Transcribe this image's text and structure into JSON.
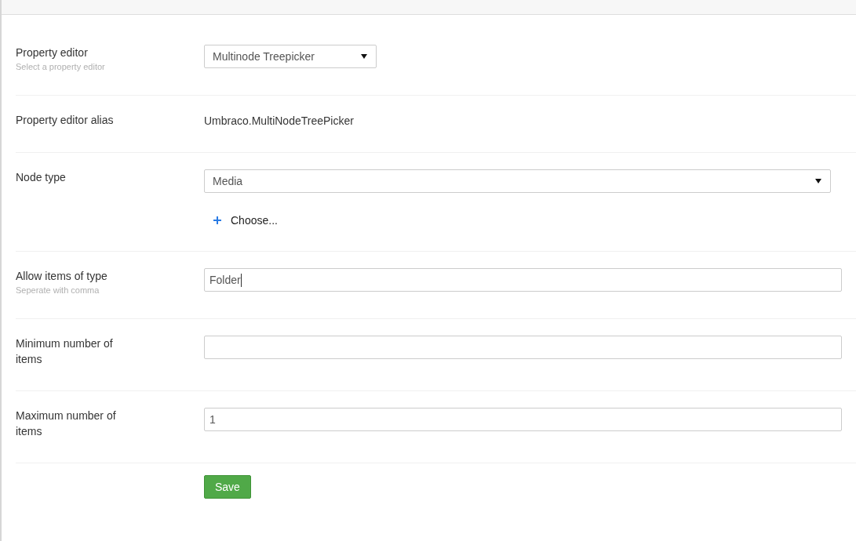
{
  "rows": [
    {
      "label": "Property editor",
      "description": "Select a property editor",
      "control": {
        "kind": "select-compact",
        "value": "Multinode Treepicker"
      }
    },
    {
      "label": "Property editor alias",
      "control": {
        "kind": "text",
        "value": "Umbraco.MultiNodeTreePicker"
      }
    },
    {
      "label": "Node type",
      "control": {
        "kind": "select",
        "value": "Media",
        "action": "Choose..."
      }
    },
    {
      "label": "Allow items of type",
      "description": "Seperate with comma",
      "control": {
        "kind": "input",
        "value": "Folder",
        "focused": true
      }
    },
    {
      "label": "Minimum number of items",
      "control": {
        "kind": "input",
        "focused": false
      }
    },
    {
      "label": "Maximum number of items",
      "control": {
        "kind": "input",
        "value": "1",
        "focused": false
      }
    }
  ],
  "save_button": "Save"
}
